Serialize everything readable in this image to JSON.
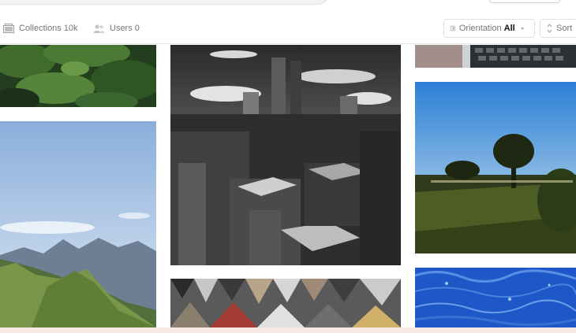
{
  "filters": {
    "collections": {
      "label": "Collections",
      "count": "10k"
    },
    "users": {
      "label": "Users",
      "count": "0"
    }
  },
  "orientation": {
    "label": "Orientation",
    "value": "All"
  },
  "sort": {
    "label": "Sort"
  },
  "icons": {
    "collections": "collections-icon",
    "users": "users-icon",
    "orientation": "orientation-icon",
    "sort": "sort-icon",
    "caret": "chevron-down-icon"
  },
  "colors": {
    "text": "#767676",
    "strong": "#111111",
    "border": "#e1e1e1"
  }
}
